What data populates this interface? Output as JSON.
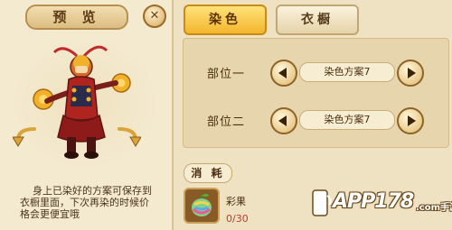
{
  "preview": {
    "title": "预 览",
    "close_label": "✕",
    "description": "身上已染好的方案可保存到衣橱里面，下次再染的时候价格会更便宜哦"
  },
  "tabs": [
    {
      "label": "染色",
      "active": true
    },
    {
      "label": "衣橱",
      "active": false
    }
  ],
  "parts": [
    {
      "label": "部位一",
      "scheme": "染色方案7"
    },
    {
      "label": "部位二",
      "scheme": "染色方案7"
    }
  ],
  "consume": {
    "label": "消 耗",
    "item_name": "彩果",
    "item_count": "0/30",
    "item_icon": "rainbow-fruit-icon"
  },
  "watermark": {
    "text": "APP178",
    "sub": ".com手游网"
  },
  "colors": {
    "active_tab": "#f3b62d",
    "background": "#efe2c2",
    "count_red": "#c0392b"
  }
}
